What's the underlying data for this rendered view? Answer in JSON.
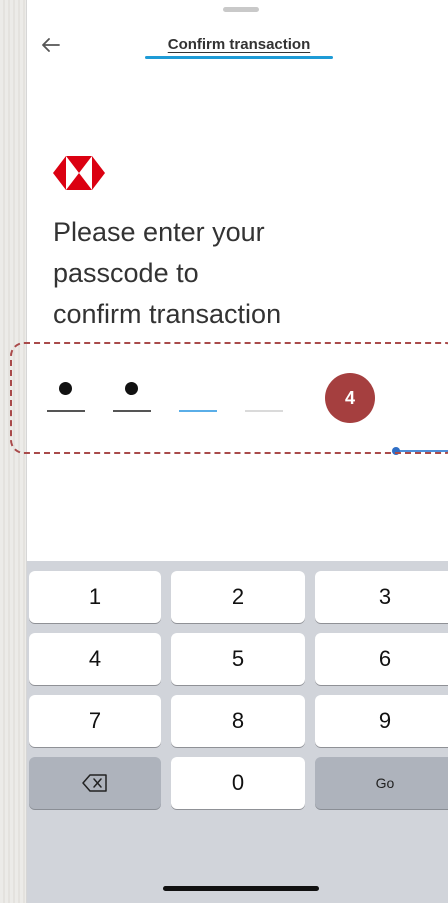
{
  "header": {
    "back_icon": "arrow-left-icon",
    "title": "Confirm transaction"
  },
  "logo": {
    "name": "brand-logo",
    "color": "#db0011"
  },
  "prompt": {
    "line1": "Please enter your",
    "line2": "passcode to",
    "line3": "confirm transaction"
  },
  "passcode": {
    "length": 4,
    "entered": 2
  },
  "annotation": {
    "step_number": "4"
  },
  "keypad": {
    "keys": [
      "1",
      "2",
      "3",
      "4",
      "5",
      "6",
      "7",
      "8",
      "9"
    ],
    "zero": "0",
    "delete_icon": "backspace-icon",
    "go_label": "Go"
  },
  "colors": {
    "accent": "#1e9bd6",
    "annotation_red": "#a53f3f",
    "keypad_bg": "#d1d4da"
  }
}
